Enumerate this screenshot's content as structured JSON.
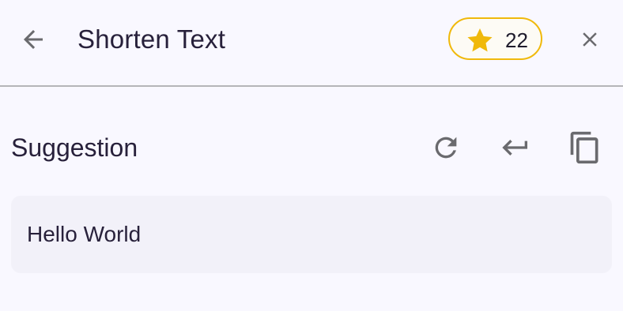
{
  "header": {
    "title": "Shorten Text",
    "credits": "22"
  },
  "suggestion": {
    "heading": "Suggestion",
    "text": "Hello World"
  },
  "icons": {
    "back": "arrow-left-icon",
    "star": "star-icon",
    "close": "close-icon",
    "refresh": "refresh-icon",
    "insert": "enter-icon",
    "copy": "copy-icon"
  },
  "colors": {
    "accent": "#f0b90b",
    "text": "#28213b",
    "icon": "#6a6a6e",
    "background": "#f9f8ff",
    "result_background": "#f2f1f9"
  }
}
